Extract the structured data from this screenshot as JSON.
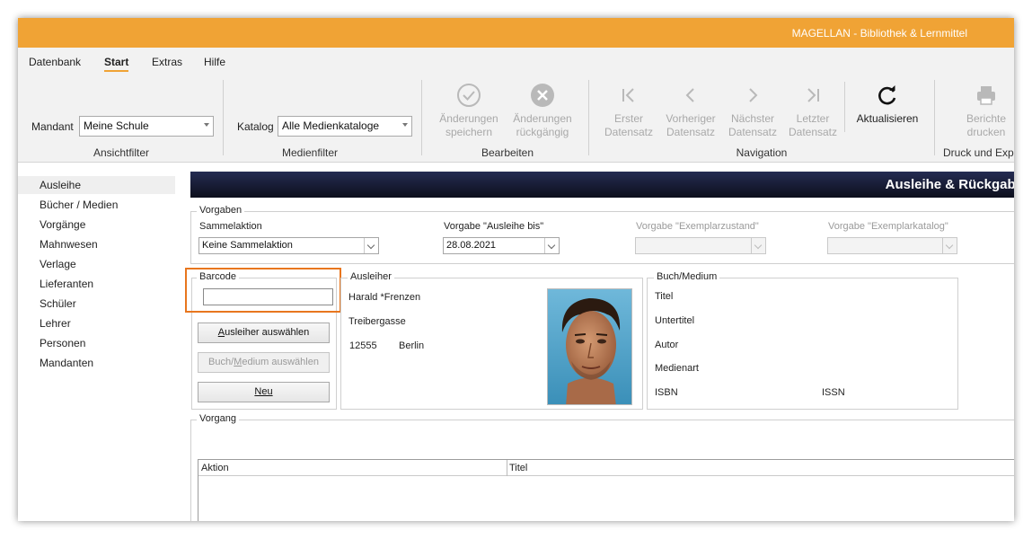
{
  "window": {
    "title": "MAGELLAN - Bibliothek & Lernmittel"
  },
  "menu": {
    "tabs": [
      "Datenbank",
      "Start",
      "Extras",
      "Hilfe"
    ],
    "active": "Start"
  },
  "ribbon": {
    "ansichtfilter": {
      "label": "Mandant",
      "value": "Meine Schule",
      "group": "Ansichtfilter"
    },
    "medienfilter": {
      "label": "Katalog",
      "value": "Alle Medienkataloge",
      "group": "Medienfilter"
    },
    "bearbeiten": {
      "group": "Bearbeiten",
      "save": [
        "Änderungen",
        "speichern"
      ],
      "undo": [
        "Änderungen",
        "rückgängig"
      ]
    },
    "navigation": {
      "group": "Navigation",
      "first": [
        "Erster",
        "Datensatz"
      ],
      "prev": [
        "Vorheriger",
        "Datensatz"
      ],
      "next": [
        "Nächster",
        "Datensatz"
      ],
      "last": [
        "Letzter",
        "Datensatz"
      ],
      "refresh": "Aktualisieren"
    },
    "druck": {
      "group": "Druck und Exp",
      "reports": [
        "Berichte",
        "drucken"
      ]
    }
  },
  "sidebar": {
    "items": [
      "Ausleihe",
      "Bücher / Medien",
      "Vorgänge",
      "Mahnwesen",
      "Verlage",
      "Lieferanten",
      "Schüler",
      "Lehrer",
      "Personen",
      "Mandanten"
    ],
    "selected": "Ausleihe"
  },
  "content": {
    "header": "Ausleihe & Rückgabe",
    "vorgaben": {
      "legend": "Vorgaben",
      "sammelaktion_label": "Sammelaktion",
      "sammelaktion_value": "Keine Sammelaktion",
      "ausleihe_bis_label": "Vorgabe \"Ausleihe bis\"",
      "ausleihe_bis_value": "28.08.2021",
      "zustand_label": "Vorgabe \"Exemplarzustand\"",
      "katalog_label": "Vorgabe \"Exemplarkatalog\""
    },
    "barcode": {
      "legend": "Barcode",
      "value": "",
      "btn_ausleiher": "Ausleiher auswählen",
      "btn_ausleiher_ul": "A",
      "btn_medium_pre": "Buch/",
      "btn_medium_ul": "M",
      "btn_medium_post": "edium auswählen",
      "btn_neu": "Neu"
    },
    "ausleiher": {
      "legend": "Ausleiher",
      "name": "Harald *Frenzen",
      "street": "Treibergasse",
      "zip": "12555",
      "city": "Berlin"
    },
    "medium": {
      "legend": "Buch/Medium",
      "titel": "Titel",
      "untertitel": "Untertitel",
      "autor": "Autor",
      "medienart": "Medienart",
      "isbn": "ISBN",
      "issn": "ISSN"
    },
    "vorgang": {
      "legend": "Vorgang",
      "columns": [
        "Aktion",
        "Titel"
      ]
    }
  },
  "colors": {
    "accent": "#f0a335",
    "highlight": "#e8761e",
    "header_dark": "#1a1f3a"
  }
}
